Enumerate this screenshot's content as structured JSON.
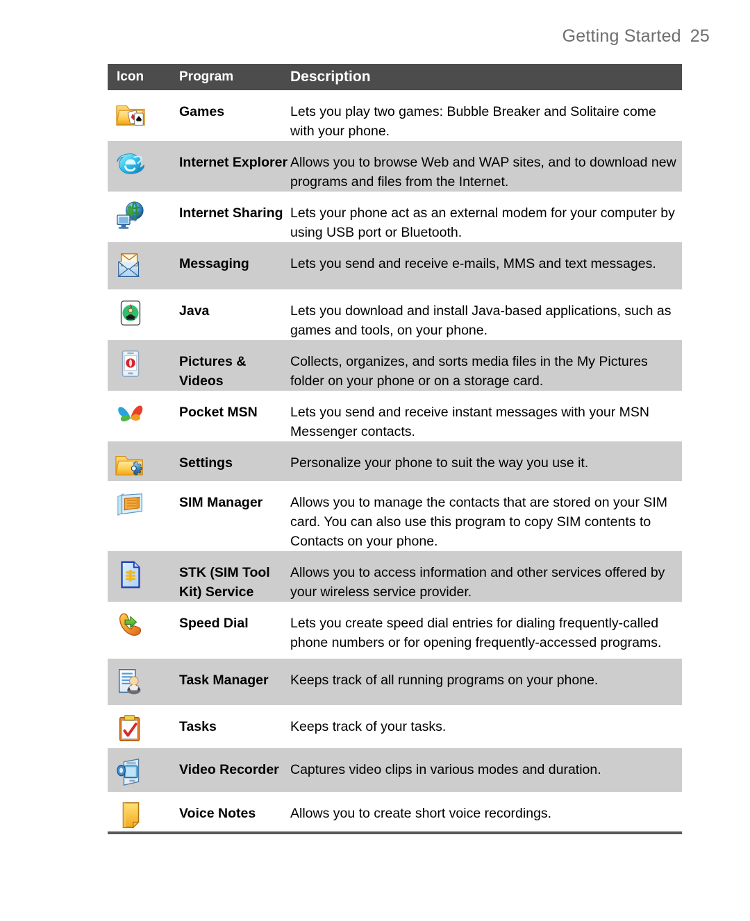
{
  "header": {
    "title": "Getting Started",
    "page_number": "25"
  },
  "table": {
    "columns": {
      "icon": "Icon",
      "program": "Program",
      "description": "Description"
    },
    "rows": [
      {
        "icon_name": "games-folder-icon",
        "program": "Games",
        "description": "Lets you play two games: Bubble Breaker and Solitaire come with your phone.",
        "shade": "plain"
      },
      {
        "icon_name": "internet-explorer-icon",
        "program": "Internet Explorer",
        "description": "Allows you to browse Web and WAP sites, and to download new programs and files from the Internet.",
        "shade": "alt"
      },
      {
        "icon_name": "internet-sharing-icon",
        "program": "Internet Sharing",
        "description": "Lets your phone act as an external modem for your computer by using USB port or Bluetooth.",
        "shade": "plain"
      },
      {
        "icon_name": "messaging-envelope-icon",
        "program": "Messaging",
        "description": "Lets you send and receive e-mails, MMS and text messages.",
        "shade": "alt"
      },
      {
        "icon_name": "java-icon",
        "program": "Java",
        "description": "Lets you download and install Java-based applications, such as games and tools, on your phone.",
        "shade": "plain"
      },
      {
        "icon_name": "pictures-videos-icon",
        "program": "Pictures & Videos",
        "description": "Collects, organizes, and sorts media files in the My Pictures folder on your phone or on a storage card.",
        "shade": "alt"
      },
      {
        "icon_name": "pocket-msn-butterfly-icon",
        "program": "Pocket MSN",
        "description": "Lets you send and receive instant messages with your MSN Messenger contacts.",
        "shade": "plain"
      },
      {
        "icon_name": "settings-gear-folder-icon",
        "program": "Settings",
        "description": "Personalize your phone to suit the way you use it.",
        "shade": "alt"
      },
      {
        "icon_name": "sim-manager-icon",
        "program": "SIM Manager",
        "description": "Allows you to manage the contacts that are stored on your SIM card. You can also use this program to copy SIM contents to Contacts on your phone.",
        "shade": "plain"
      },
      {
        "icon_name": "stk-sim-card-icon",
        "program": "STK (SIM Tool Kit) Service",
        "description": "Allows you to access information and other services offered by your wireless service provider.",
        "shade": "alt"
      },
      {
        "icon_name": "speed-dial-icon",
        "program": "Speed Dial",
        "description": "Lets you create speed dial entries for dialing frequently-called phone numbers or for opening frequently-accessed programs.",
        "shade": "plain"
      },
      {
        "icon_name": "task-manager-icon",
        "program": "Task Manager",
        "description": "Keeps track of all running programs on your phone.",
        "shade": "alt"
      },
      {
        "icon_name": "tasks-clipboard-icon",
        "program": "Tasks",
        "description": "Keeps track of your tasks.",
        "shade": "plain"
      },
      {
        "icon_name": "video-recorder-icon",
        "program": "Video Recorder",
        "description": "Captures video clips in various modes and duration.",
        "shade": "alt"
      },
      {
        "icon_name": "voice-notes-icon",
        "program": "Voice Notes",
        "description": "Allows you to create short voice recordings.",
        "shade": "plain"
      }
    ]
  },
  "colors": {
    "header_bar": "#4c4c4c",
    "alt_row": "#cdcdcd",
    "page_header_text": "#6d6e70",
    "bottom_rule": "#58595b"
  }
}
